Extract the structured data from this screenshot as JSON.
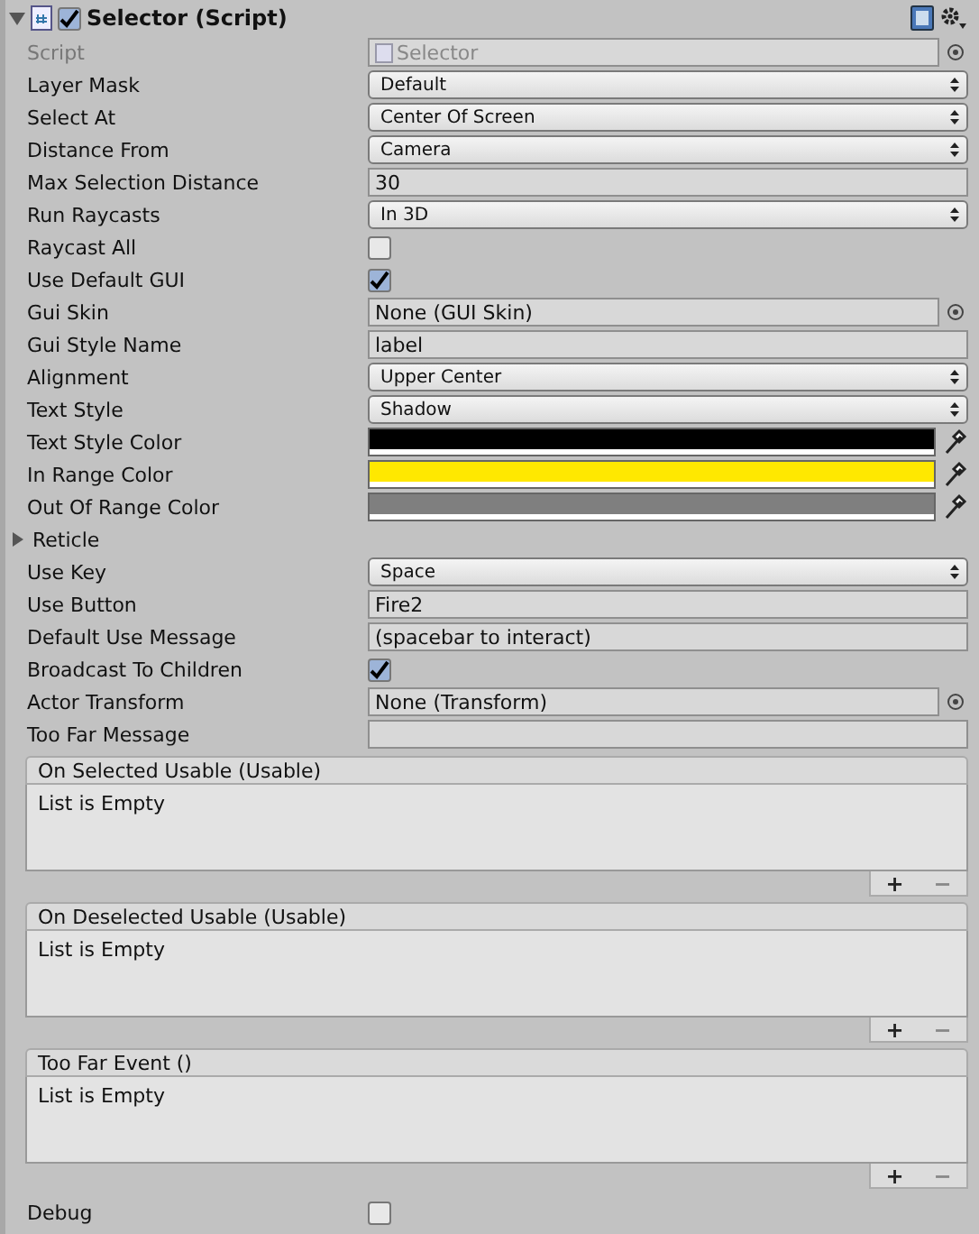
{
  "component": {
    "title": "Selector (Script)",
    "enabled": true,
    "expanded": true
  },
  "fields": [
    {
      "kind": "object",
      "label": "Script",
      "value": "Selector",
      "disabled": true
    },
    {
      "kind": "dropdown",
      "label": "Layer Mask",
      "value": "Default"
    },
    {
      "kind": "dropdown",
      "label": "Select At",
      "value": "Center Of Screen"
    },
    {
      "kind": "dropdown",
      "label": "Distance From",
      "value": "Camera"
    },
    {
      "kind": "text",
      "label": "Max Selection Distance",
      "value": "30"
    },
    {
      "kind": "dropdown",
      "label": "Run Raycasts",
      "value": "In 3D"
    },
    {
      "kind": "checkbox",
      "label": "Raycast All",
      "checked": false
    },
    {
      "kind": "checkbox",
      "label": "Use Default GUI",
      "checked": true
    },
    {
      "kind": "object",
      "label": "Gui Skin",
      "value": "None (GUI Skin)"
    },
    {
      "kind": "text",
      "label": "Gui Style Name",
      "value": "label"
    },
    {
      "kind": "dropdown",
      "label": "Alignment",
      "value": "Upper Center"
    },
    {
      "kind": "dropdown",
      "label": "Text Style",
      "value": "Shadow"
    },
    {
      "kind": "color",
      "label": "Text Style Color",
      "color": "#000000"
    },
    {
      "kind": "color",
      "label": "In Range Color",
      "color": "#ffe800"
    },
    {
      "kind": "color",
      "label": "Out Of Range Color",
      "color": "#7f7f7f"
    },
    {
      "kind": "foldout",
      "label": "Reticle",
      "expanded": false
    },
    {
      "kind": "dropdown",
      "label": "Use Key",
      "value": "Space"
    },
    {
      "kind": "text",
      "label": "Use Button",
      "value": "Fire2"
    },
    {
      "kind": "text",
      "label": "Default Use Message",
      "value": "(spacebar to interact)"
    },
    {
      "kind": "checkbox",
      "label": "Broadcast To Children",
      "checked": true
    },
    {
      "kind": "object",
      "label": "Actor Transform",
      "value": "None (Transform)"
    },
    {
      "kind": "text",
      "label": "Too Far Message"
    }
  ],
  "events": [
    {
      "title": "On Selected Usable (Usable)",
      "message": "List is Empty",
      "add": "+",
      "remove": "−"
    },
    {
      "title": "On Deselected Usable (Usable)",
      "message": "List is Empty",
      "add": "+",
      "remove": "−"
    },
    {
      "title": "Too Far Event ()",
      "message": "List is Empty",
      "add": "+",
      "remove": "−"
    }
  ],
  "footer_fields": [
    {
      "kind": "checkbox",
      "label": "Debug",
      "checked": false
    }
  ]
}
